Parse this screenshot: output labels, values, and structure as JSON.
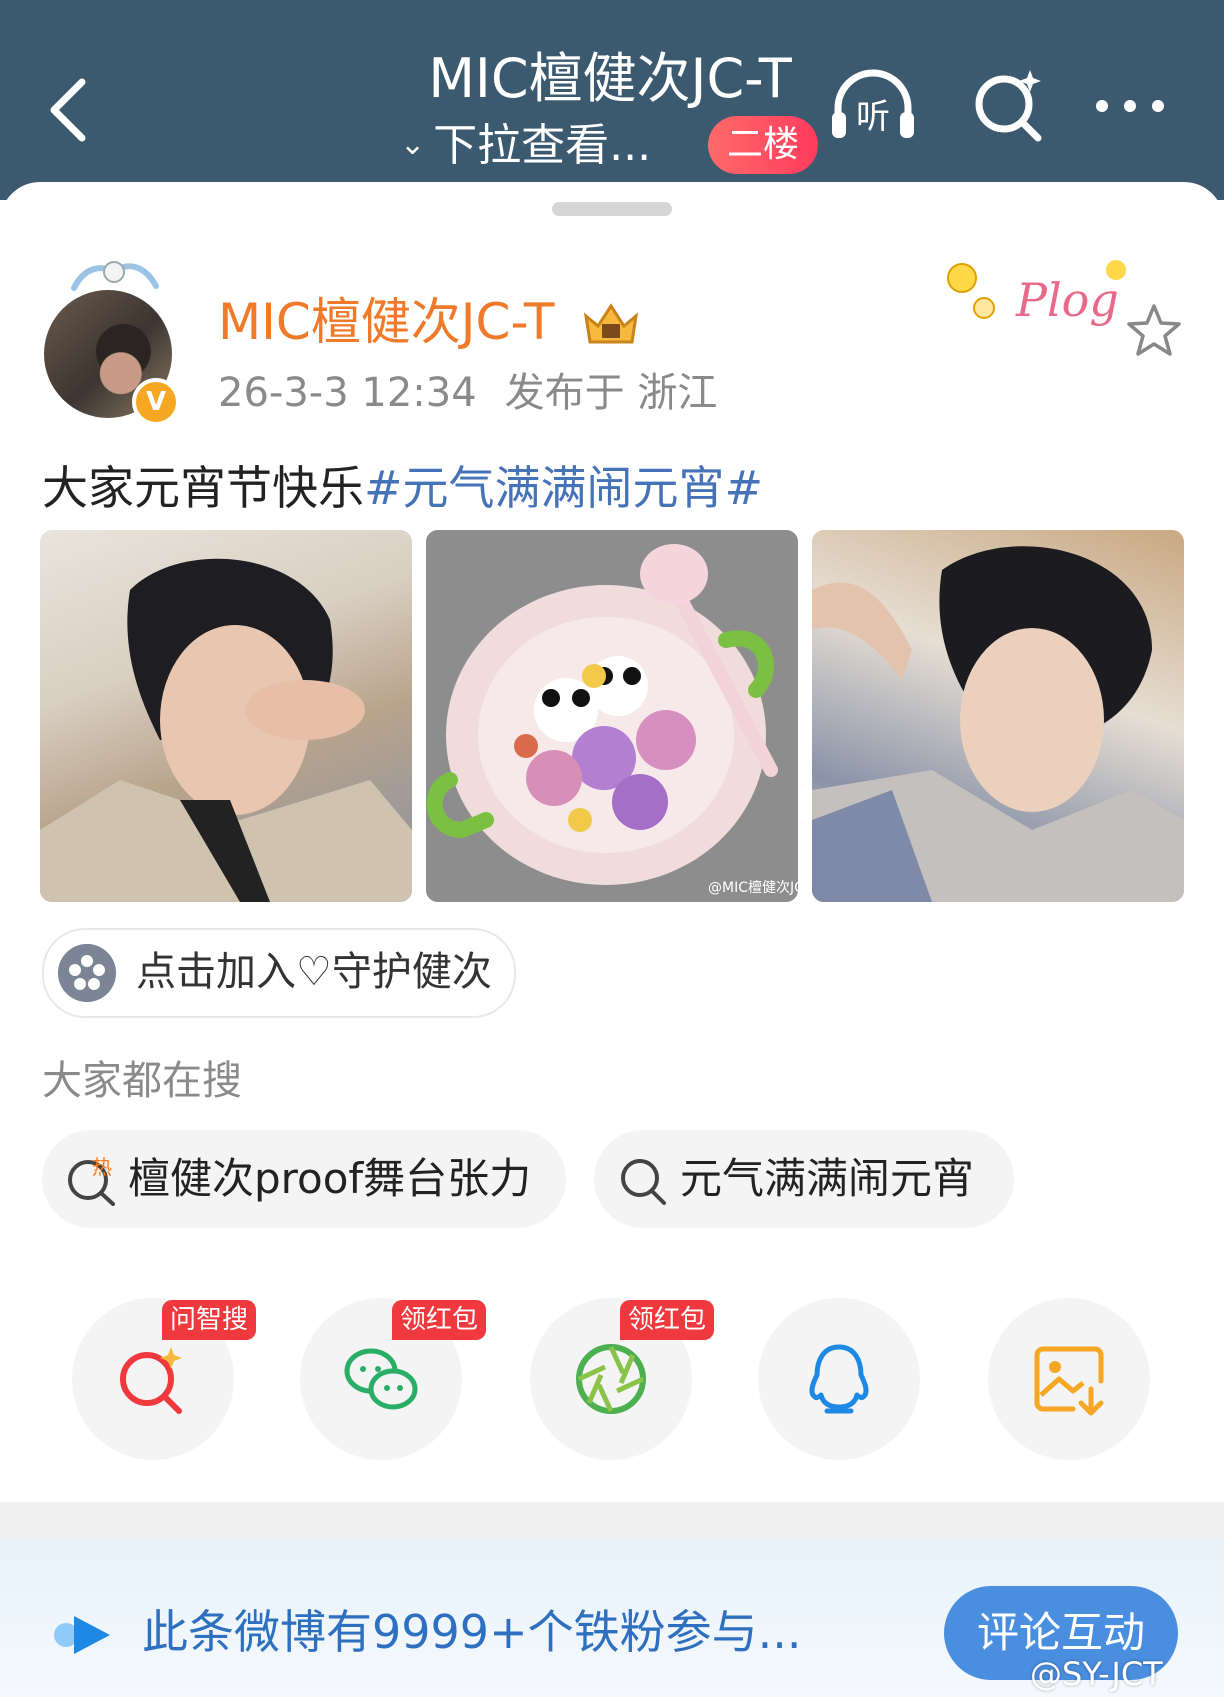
{
  "header": {
    "title": "MIC檀健次JC-T",
    "subtitle": "下拉查看...",
    "floor_badge": "二楼",
    "listen_label": "听"
  },
  "post": {
    "username": "MIC檀健次JC-T",
    "date": "26-3-3 12:34",
    "location": "发布于 浙江",
    "text": "大家元宵节快乐",
    "hashtag": "#元气满满闹元宵#",
    "photo_watermark": "@MIC檀健次JC-T",
    "sticker_text": "Plog"
  },
  "join": {
    "label": "点击加入♡守护健次"
  },
  "searches": {
    "title": "大家都在搜",
    "hot_badge": "热",
    "items": [
      "檀健次proof舞台张力",
      "元气满满闹元宵"
    ]
  },
  "share": {
    "items": [
      {
        "name": "ai-search",
        "badge": "问智搜"
      },
      {
        "name": "wechat",
        "badge": "领红包"
      },
      {
        "name": "moments",
        "badge": "领红包"
      },
      {
        "name": "qq",
        "badge": ""
      },
      {
        "name": "save-image",
        "badge": ""
      }
    ]
  },
  "banner": {
    "text": "此条微博有9999+个铁粉参与...",
    "button": "评论互动"
  },
  "watermark": "@SY-JCT",
  "colors": {
    "header_bg": "#3b5a70",
    "username": "#f07a2a",
    "hashtag": "#4673b8",
    "banner_text": "#2f6fbf",
    "badge_red": "#f0393e"
  }
}
